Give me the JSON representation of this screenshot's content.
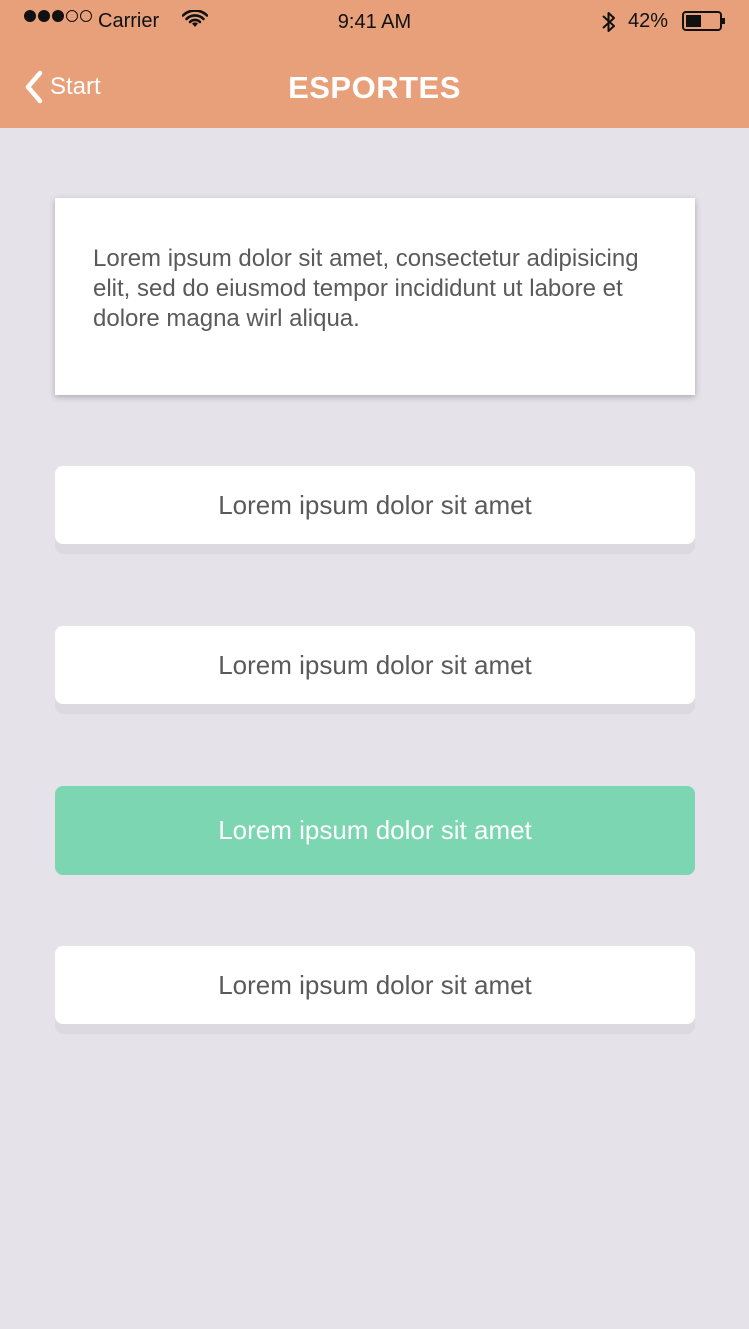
{
  "status_bar": {
    "carrier": "Carrier",
    "time": "9:41 AM",
    "battery": "42%",
    "signal_bars": 3
  },
  "nav": {
    "back_label": "Start",
    "title": "ESPORTES"
  },
  "card": {
    "text": "Lorem ipsum dolor sit amet, consectetur adipisicing elit, sed do eiusmod tempor incididunt ut labore et dolore magna wirl aliqua."
  },
  "options": [
    {
      "label": "Lorem ipsum dolor sit amet",
      "selected": false
    },
    {
      "label": "Lorem ipsum dolor sit amet",
      "selected": false
    },
    {
      "label": "Lorem ipsum dolor sit amet",
      "selected": true
    },
    {
      "label": "Lorem ipsum dolor sit amet",
      "selected": false
    }
  ],
  "colors": {
    "header": "#E8A07B",
    "background": "#E5E2E9",
    "selected": "#7BD6B1"
  }
}
